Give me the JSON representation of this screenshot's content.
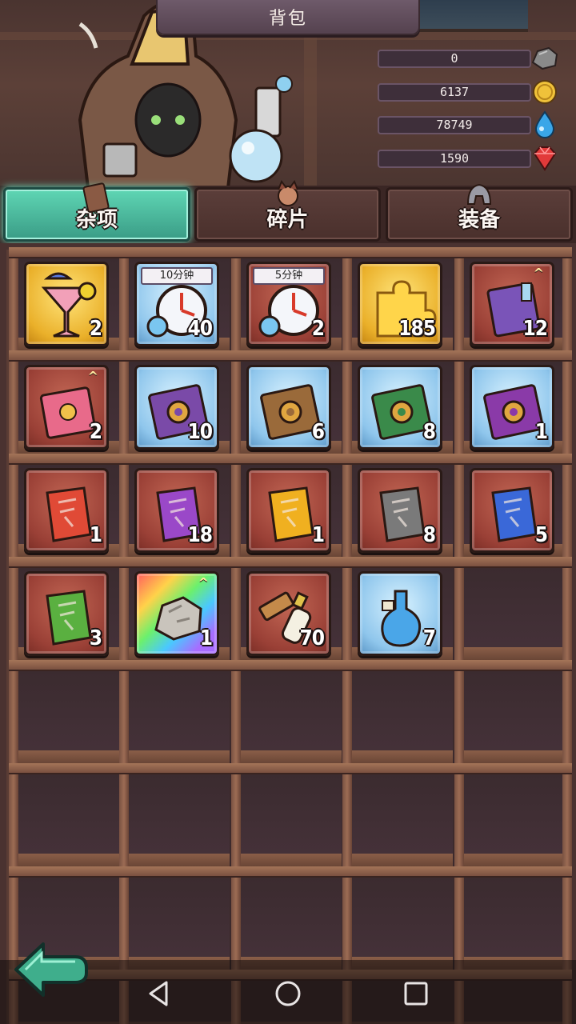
{
  "header": {
    "title": "背包"
  },
  "resources": [
    {
      "name": "stone",
      "value": "0",
      "icon": "stone-icon"
    },
    {
      "name": "gold",
      "value": "6137",
      "icon": "gold-coin-icon"
    },
    {
      "name": "water",
      "value": "78749",
      "icon": "water-drop-icon"
    },
    {
      "name": "gem",
      "value": "1590",
      "icon": "red-gem-icon"
    }
  ],
  "tabs": [
    {
      "label": "杂项",
      "active": true
    },
    {
      "label": "碎片",
      "active": false
    },
    {
      "label": "装备",
      "active": false
    }
  ],
  "items": [
    {
      "icon": "cocktail-icon",
      "frame": "gold",
      "qty": "2"
    },
    {
      "icon": "clock-potion-icon",
      "frame": "blue",
      "qty": "40",
      "tag": "10分钟"
    },
    {
      "icon": "clock-potion-icon",
      "frame": "red",
      "qty": "2",
      "tag": "5分钟"
    },
    {
      "icon": "puzzle-piece-icon",
      "frame": "gold",
      "qty": "185"
    },
    {
      "icon": "purple-book-icon",
      "frame": "red",
      "qty": "12",
      "upgrade": true
    },
    {
      "icon": "pink-book-icon",
      "frame": "red",
      "qty": "2",
      "upgrade": true
    },
    {
      "icon": "purple-gear-tome-icon",
      "frame": "blue",
      "qty": "10"
    },
    {
      "icon": "brown-gear-tome-icon",
      "frame": "blue",
      "qty": "6"
    },
    {
      "icon": "green-gear-tome-icon",
      "frame": "blue",
      "qty": "8"
    },
    {
      "icon": "violet-gear-tome-icon",
      "frame": "blue",
      "qty": "1"
    },
    {
      "icon": "red-scroll-icon",
      "frame": "red",
      "qty": "1"
    },
    {
      "icon": "purple-scroll-icon",
      "frame": "red",
      "qty": "18"
    },
    {
      "icon": "yellow-scroll-icon",
      "frame": "red",
      "qty": "1"
    },
    {
      "icon": "gray-scroll-icon",
      "frame": "red",
      "qty": "8"
    },
    {
      "icon": "blue-scroll-icon",
      "frame": "red",
      "qty": "5"
    },
    {
      "icon": "green-scroll-icon",
      "frame": "red",
      "qty": "3"
    },
    {
      "icon": "ore-rock-icon",
      "frame": "rainbow",
      "qty": "1",
      "upgrade": true
    },
    {
      "icon": "hammer-bottle-icon",
      "frame": "red",
      "qty": "70"
    },
    {
      "icon": "blue-potion-icon",
      "frame": "blue",
      "qty": "7"
    }
  ],
  "upgrade_mark": "^",
  "colors": {
    "active_tab": "#4cc4a4",
    "shelf_wood": "#8a5e48",
    "rare_frame": "#8fc6ec",
    "epic_frame": "#eab02a"
  }
}
